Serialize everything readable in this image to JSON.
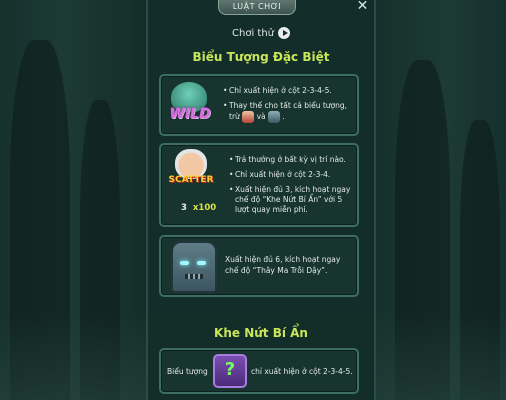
{
  "header": {
    "tab_title": "LUẬT CHƠI",
    "close_icon": "close-icon"
  },
  "demo": {
    "label": "Chơi thử",
    "icon": "play-icon"
  },
  "special_symbols": {
    "title": "Biểu Tượng Đặc Biệt",
    "wild": {
      "symbol_label": "WILD",
      "rules": [
        "Chỉ xuất hiện ở cột 2-3-4-5.",
        "Thay thế cho tất cả biểu tượng,"
      ],
      "except_prefix": "trừ",
      "except_joiner": "và",
      "except_suffix": "."
    },
    "scatter": {
      "symbol_label": "SCATTER",
      "count": "3",
      "multiplier": "x100",
      "rules": [
        "Trả thưởng ở bất kỳ vị trí nào.",
        "Chỉ xuất hiện ở cột 2-3-4.",
        "Xuất hiện đủ 3, kích hoạt ngay chế độ “Khe Nứt Bí Ẩn” với 5 lượt quay miễn phí."
      ]
    },
    "tombstone": {
      "description": "Xuất hiện đủ 6, kích hoạt ngay chế độ “Thây Ma Trỗi Dậy”."
    }
  },
  "mystery_crack": {
    "title": "Khe Nứt Bí Ẩn",
    "prefix": "Biểu tượng",
    "suffix": "chỉ xuất hiện ở cột 2-3-4-5.",
    "symbol_glyph": "?"
  },
  "colors": {
    "accent_title": "#c9e65a",
    "panel_bg": "#122d2a",
    "card_border": "#3e6d63",
    "scatter_multiplier": "#d7e34b"
  }
}
